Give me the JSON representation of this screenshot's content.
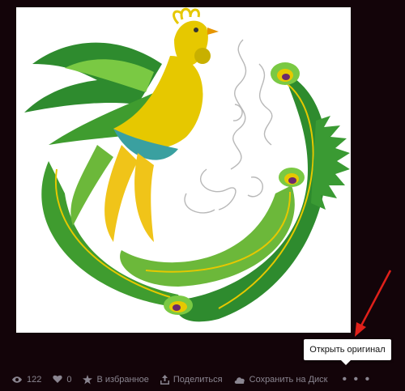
{
  "image": {
    "alt": ""
  },
  "tooltip": {
    "text": "Открыть оригинал"
  },
  "toolbar": {
    "views": "122",
    "likes": "0",
    "favorite_label": "В избранное",
    "share_label": "Поделиться",
    "save_disk_label": "Сохранить на Диск",
    "more_label": "• • •"
  },
  "colors": {
    "background": "#130409",
    "annotation_arrow": "#e0201a"
  }
}
